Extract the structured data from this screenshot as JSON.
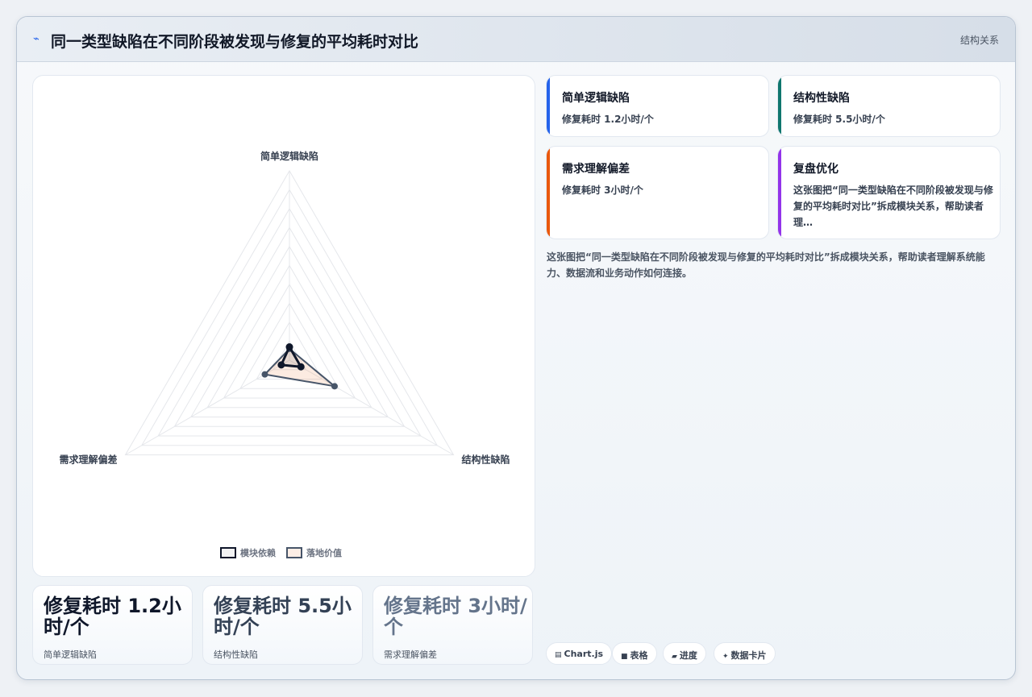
{
  "header": {
    "title": "同一类型缺陷在不同阶段被发现与修复的平均耗时对比",
    "tag": "结构关系",
    "icon": "spark-icon"
  },
  "chart_data": {
    "type": "radar",
    "axes": [
      "简单逻辑缺陷",
      "结构性缺陷",
      "需求理解偏差"
    ],
    "rmax": 20,
    "rings": 10,
    "series": [
      {
        "name": "模块依赖",
        "values": [
          1.4,
          1.4,
          1.0
        ],
        "color": "#1e293b"
      },
      {
        "name": "落地价值",
        "values": [
          1.2,
          5.5,
          3.0
        ],
        "color": "#475569"
      }
    ],
    "legend_position": "bottom"
  },
  "stats": [
    {
      "value": "修复耗时 1.2小时/个",
      "label": "简单逻辑缺陷"
    },
    {
      "value": "修复耗时 5.5小时/个",
      "label": "结构性缺陷"
    },
    {
      "value": "修复耗时 3小时/个",
      "label": "需求理解偏差"
    }
  ],
  "cards": [
    {
      "title": "简单逻辑缺陷",
      "body": "修复耗时 1.2小时/个",
      "color": "#2563eb"
    },
    {
      "title": "结构性缺陷",
      "body": "修复耗时 5.5小时/个",
      "color": "#0f766e"
    },
    {
      "title": "需求理解偏差",
      "body": "修复耗时 3小时/个",
      "color": "#ea580c"
    },
    {
      "title": "复盘优化",
      "body": "这张图把“同一类型缺陷在不同阶段被发现与修复的平均耗时对比”拆成模块关系，帮助读者理…",
      "color": "#9333ea"
    }
  ],
  "summary": "这张图把“同一类型缺陷在不同阶段被发现与修复的平均耗时对比”拆成模块关系，帮助读者理解系统能力、数据流和业务动作如何连接。",
  "chips": [
    {
      "icon": "chart-icon",
      "glyph": "▤",
      "label": "Chart.js"
    },
    {
      "icon": "table-icon",
      "glyph": "■",
      "label": "表格"
    },
    {
      "icon": "progress-icon",
      "glyph": "▰",
      "label": "进度"
    },
    {
      "icon": "card-icon",
      "glyph": "✦",
      "label": "数据卡片"
    }
  ]
}
